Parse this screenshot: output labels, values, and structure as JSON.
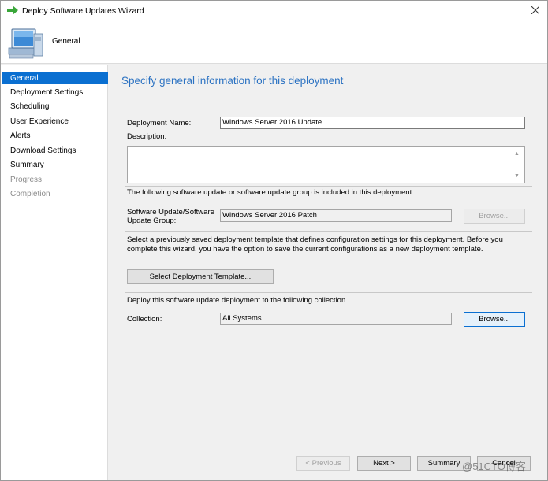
{
  "window": {
    "title": "Deploy Software Updates Wizard"
  },
  "header": {
    "title": "General",
    "icon": "computer-icon"
  },
  "sidebar": {
    "items": [
      {
        "label": "General",
        "state": "active"
      },
      {
        "label": "Deployment Settings",
        "state": "normal"
      },
      {
        "label": "Scheduling",
        "state": "normal"
      },
      {
        "label": "User Experience",
        "state": "normal"
      },
      {
        "label": "Alerts",
        "state": "normal"
      },
      {
        "label": "Download Settings",
        "state": "normal"
      },
      {
        "label": "Summary",
        "state": "normal"
      },
      {
        "label": "Progress",
        "state": "disabled"
      },
      {
        "label": "Completion",
        "state": "disabled"
      }
    ]
  },
  "main": {
    "heading": "Specify general information for this deployment",
    "deployment_name_label": "Deployment Name:",
    "deployment_name_value": "Windows Server 2016 Update",
    "description_label": "Description:",
    "description_value": "",
    "included_text": "The following software update or software update group is included in this deployment.",
    "update_group_label": "Software Update/Software Update Group:",
    "update_group_value": "Windows Server 2016 Patch",
    "browse_update_label": "Browse...",
    "template_text": "Select a previously saved deployment template that defines configuration settings for this deployment. Before you complete this wizard, you have the option to save the current configurations as a new deployment template.",
    "select_template_label": "Select Deployment Template...",
    "collection_text": "Deploy this software update deployment to the following collection.",
    "collection_label": "Collection:",
    "collection_value": "All Systems",
    "browse_collection_label": "Browse..."
  },
  "footer": {
    "previous_label": "< Previous",
    "next_label": "Next >",
    "summary_label": "Summary",
    "cancel_label": "Cancel"
  },
  "watermark": "@51CTO博客",
  "colors": {
    "accent": "#0a6fd1",
    "heading": "#2b72c2"
  }
}
